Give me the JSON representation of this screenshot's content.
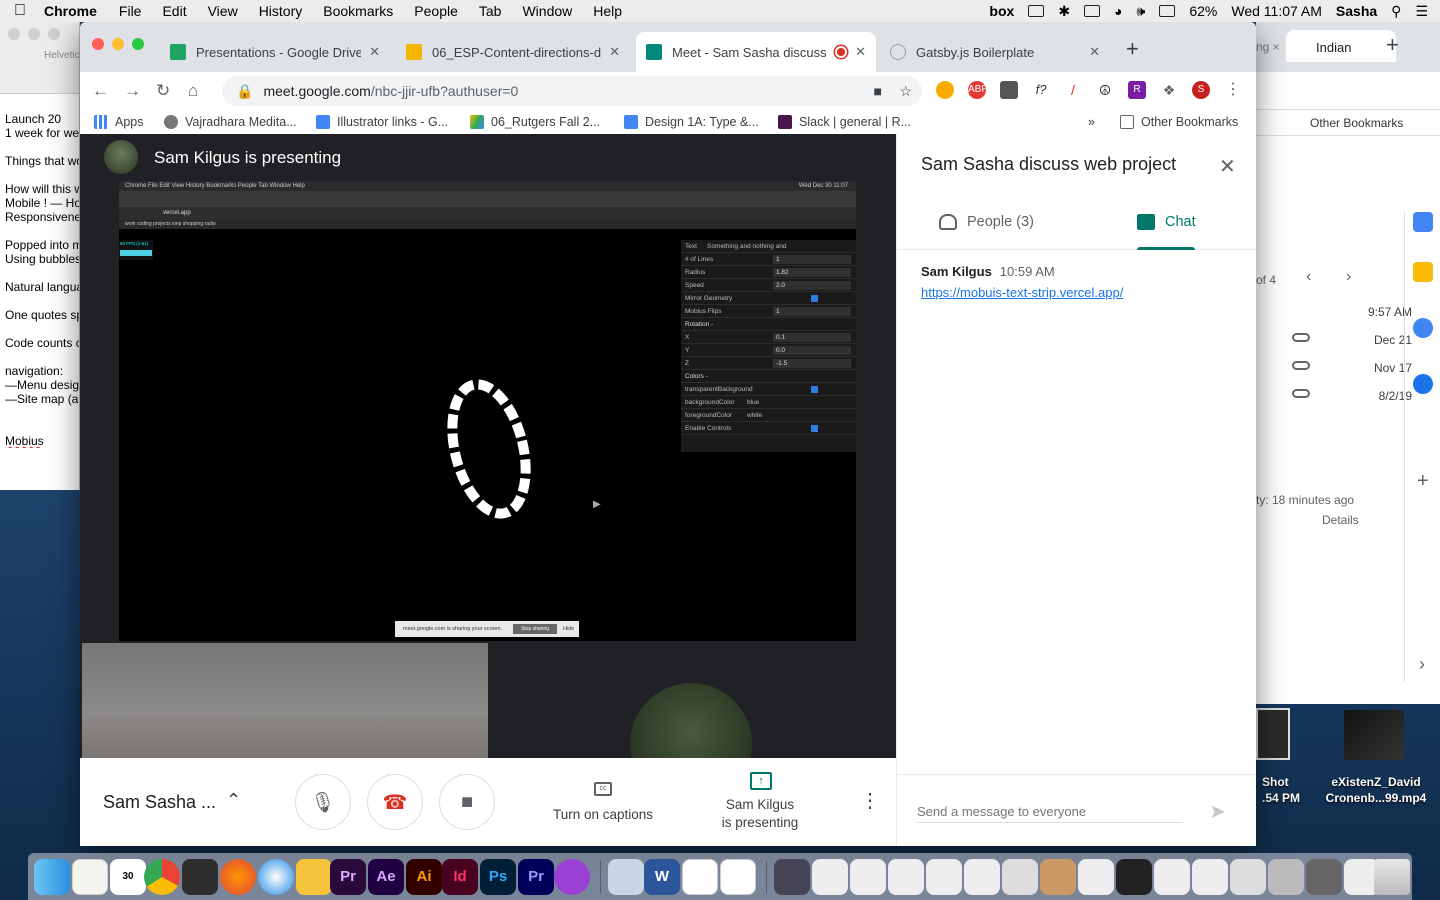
{
  "menubar": {
    "app": "Chrome",
    "items": [
      "File",
      "Edit",
      "View",
      "History",
      "Bookmarks",
      "People",
      "Tab",
      "Window",
      "Help"
    ],
    "battery": "62%",
    "clock": "Wed 11:07 AM",
    "user": "Sasha",
    "box_label": "box"
  },
  "textdoc": {
    "toolbar_label": "Helvetic",
    "lines": [
      "Launch 20",
      "1 week for we",
      "",
      "Things that wo",
      "",
      "How will this w",
      "Mobile ! — Ho",
      "Responsivene",
      "",
      "Popped into m",
      "Using bubbles",
      "",
      "Natural langua",
      "",
      "One quotes sp",
      "",
      "Code counts c",
      "",
      "navigation:",
      "—Menu desig",
      "—Site map (a",
      "",
      "",
      "Mobius"
    ]
  },
  "bgwin": {
    "tab_label": "Indian",
    "other_bookmarks": "Other Bookmarks",
    "pager": "of 4",
    "rows": [
      "9:57 AM",
      "Dec 21",
      "Nov 17",
      "8/2/19"
    ],
    "activity": "ty: 18 minutes ago",
    "details": "Details"
  },
  "desktop_files": [
    {
      "name": "Shot\n.54 PM"
    },
    {
      "name": "eXistenZ_David\nCronenb...99.mp4"
    }
  ],
  "chrome": {
    "tabs": [
      {
        "title": "Presentations - Google Drive",
        "color": "#1fa463"
      },
      {
        "title": "06_ESP-Content-directions-de",
        "color": "#f4b400"
      },
      {
        "title": "Meet - Sam Sasha discuss",
        "color": "#00897b"
      },
      {
        "title": "Gatsby.js Boilerplate",
        "color": "#9aa0a6"
      }
    ],
    "url_host": "meet.google.com",
    "url_path": "/nbc-jjir-ufb?authuser=0",
    "profile_initial": "S",
    "bookmarks": [
      "Apps",
      "Vajradhara Medita...",
      "Illustrator links - G...",
      "06_Rutgers Fall 2...",
      "Design 1A: Type &...",
      "Slack | general | R..."
    ],
    "bookmarks_more": "»",
    "other_bookmarks": "Other Bookmarks"
  },
  "meet": {
    "presenting_title": "Sam Kilgus is presenting",
    "meeting_short": "Sam Sasha ...",
    "captions_label": "Turn on captions",
    "presenting_label": "Sam Kilgus\nis presenting",
    "panel": {
      "title": "Sam Sasha discuss web project",
      "people_tab": "People (3)",
      "chat_tab": "Chat",
      "message": {
        "sender": "Sam Kilgus",
        "time": "10:59 AM",
        "link": "https://mobuis-text-strip.vercel.app/"
      },
      "composer_placeholder": "Send a message to everyone"
    }
  },
  "shared_screen": {
    "menu": "Chrome   File   Edit   View   History   Bookmarks   People   Tab   Window   Help",
    "clock": "Wed Dec 30  11:07",
    "address": "vercel.app",
    "bookmarks": "work    coding    projects    inep    shopping    radio",
    "fps": "60 FPS (1-61)",
    "gui_rows": [
      {
        "label": "Text",
        "value": "Something and nothing and"
      },
      {
        "label": "# of Lines",
        "value": "1"
      },
      {
        "label": "Radius",
        "value": "1.82"
      },
      {
        "label": "Speed",
        "value": "2.0"
      },
      {
        "label": "Mirror Geometry",
        "value": ""
      },
      {
        "label": "Mobius Flips",
        "value": "1"
      },
      {
        "label": "Rotation  -",
        "value": ""
      },
      {
        "label": "X",
        "value": "0.1"
      },
      {
        "label": "Y",
        "value": "0.0"
      },
      {
        "label": "Z",
        "value": "-1.5"
      },
      {
        "label": "Colors  -",
        "value": ""
      },
      {
        "label": "transparentBackground",
        "value": ""
      },
      {
        "label": "backgroundColor",
        "value": "blue"
      },
      {
        "label": "foregroundColor",
        "value": "white"
      },
      {
        "label": "Enable Controls",
        "value": ""
      }
    ],
    "share_notice": "meet.google.com is sharing your screen.",
    "stop_label": "Stop sharing",
    "hide_label": "Hide",
    "art_text": "thing and"
  },
  "dock": {
    "apps": [
      "Finder",
      "Notes",
      "Chrome",
      "Jira",
      "Firefox",
      "Safari",
      "Cyberduck",
      "Pr",
      "Ae",
      "Ai",
      "Id",
      "Ps",
      "Pr",
      "Podcasts",
      "Preview",
      "W",
      "Acrobat",
      "Slack"
    ]
  }
}
